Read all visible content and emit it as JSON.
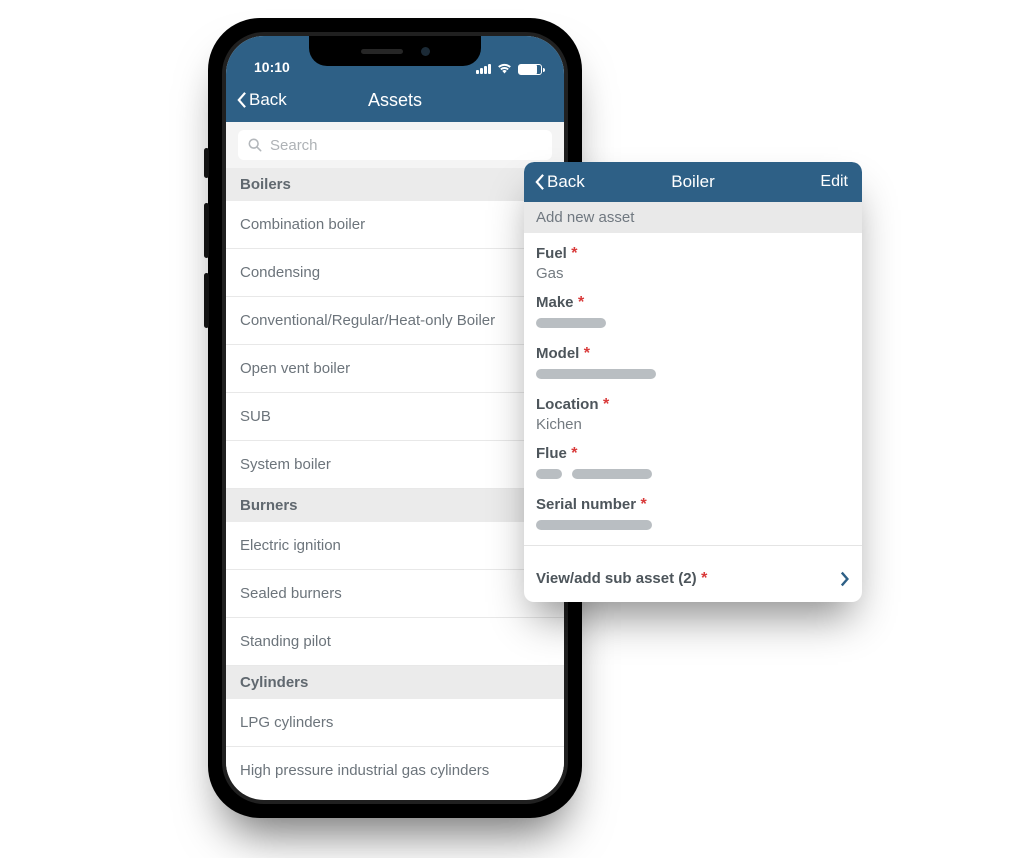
{
  "status": {
    "time": "10:10"
  },
  "assets_screen": {
    "back_label": "Back",
    "title": "Assets",
    "search_placeholder": "Search",
    "sections": [
      {
        "title": "Boilers",
        "items": [
          "Combination boiler",
          "Condensing",
          "Conventional/Regular/Heat-only Boiler",
          "Open vent boiler",
          "SUB",
          "System boiler"
        ]
      },
      {
        "title": "Burners",
        "items": [
          "Electric ignition",
          "Sealed burners",
          "Standing pilot"
        ]
      },
      {
        "title": "Cylinders",
        "items": [
          "LPG cylinders",
          "High pressure industrial gas cylinders"
        ]
      }
    ]
  },
  "detail_screen": {
    "back_label": "Back",
    "title": "Boiler",
    "edit_label": "Edit",
    "subtitle": "Add new asset",
    "fields": {
      "fuel": {
        "label": "Fuel",
        "value": "Gas"
      },
      "make": {
        "label": "Make",
        "value": ""
      },
      "model": {
        "label": "Model",
        "value": ""
      },
      "location": {
        "label": "Location",
        "value": "Kichen"
      },
      "flue": {
        "label": "Flue",
        "value": ""
      },
      "serial": {
        "label": "Serial number",
        "value": ""
      }
    },
    "sub_asset_label": "View/add sub asset (2)"
  }
}
